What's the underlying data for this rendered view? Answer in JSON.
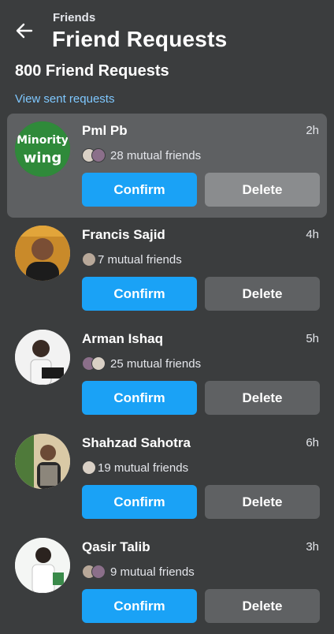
{
  "header": {
    "breadcrumb": "Friends",
    "title": "Friend Requests",
    "count_label": "800 Friend Requests",
    "sent_link": "View sent requests"
  },
  "colors": {
    "background": "#3b3d3e",
    "confirm": "#1aa2f6",
    "delete": "#5f6163",
    "link": "#7fc8ff"
  },
  "requests": [
    {
      "name": "Pml Pb",
      "time": "2h",
      "mutual": "28 mutual friends",
      "confirm": "Confirm",
      "delete": "Delete",
      "avatar_text_1": "Minority",
      "avatar_text_2": "wing"
    },
    {
      "name": "Francis Sajid",
      "time": "4h",
      "mutual": "7 mutual friends",
      "confirm": "Confirm",
      "delete": "Delete"
    },
    {
      "name": "Arman Ishaq",
      "time": "5h",
      "mutual": "25 mutual friends",
      "confirm": "Confirm",
      "delete": "Delete"
    },
    {
      "name": "Shahzad Sahotra",
      "time": "6h",
      "mutual": "19 mutual friends",
      "confirm": "Confirm",
      "delete": "Delete"
    },
    {
      "name": "Qasir Talib",
      "time": "3h",
      "mutual": "9 mutual friends",
      "confirm": "Confirm",
      "delete": "Delete"
    }
  ]
}
